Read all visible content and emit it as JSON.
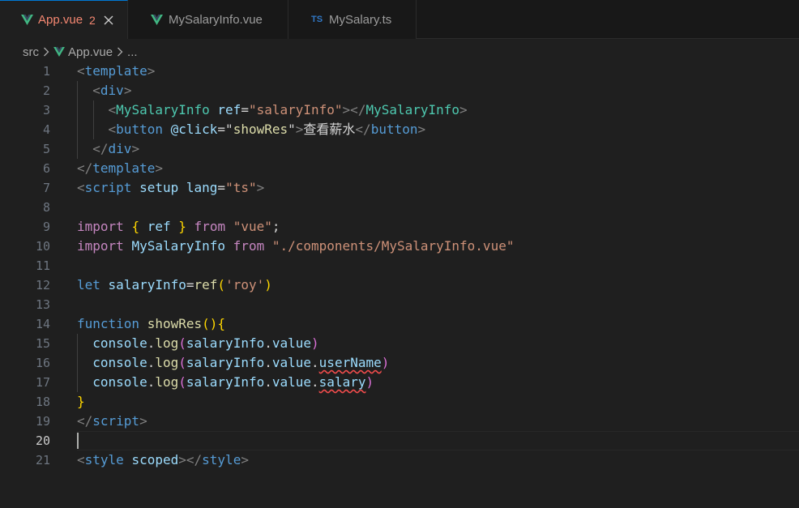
{
  "tabs": [
    {
      "label": "App.vue",
      "badge": "2",
      "icon": "vue-icon",
      "active": true
    },
    {
      "label": "MySalaryInfo.vue",
      "icon": "vue-icon",
      "active": false
    },
    {
      "label": "MySalary.ts",
      "icon": "ts-icon",
      "icon_text": "TS",
      "active": false
    }
  ],
  "breadcrumb": {
    "folder": "src",
    "file": "App.vue",
    "symbol": "..."
  },
  "colors": {
    "vue": "#41b883",
    "ts": "#3178c6",
    "accent": "#0078d4",
    "error": "#f48771"
  },
  "editor": {
    "current_line": 20,
    "lines": [
      {
        "n": "1",
        "tokens": [
          [
            "t-br",
            "<"
          ],
          [
            "t-tag",
            "template"
          ],
          [
            "t-br",
            ">"
          ]
        ]
      },
      {
        "n": "2",
        "tokens": [
          [
            "t-txt",
            "  "
          ],
          [
            "t-br",
            "<"
          ],
          [
            "t-tag",
            "div"
          ],
          [
            "t-br",
            ">"
          ]
        ]
      },
      {
        "n": "3",
        "tokens": [
          [
            "t-txt",
            "    "
          ],
          [
            "t-br",
            "<"
          ],
          [
            "t-comp",
            "MySalaryInfo"
          ],
          [
            "t-txt",
            " "
          ],
          [
            "t-attr",
            "ref"
          ],
          [
            "t-txt",
            "="
          ],
          [
            "t-str",
            "\"salaryInfo\""
          ],
          [
            "t-br",
            "></"
          ],
          [
            "t-comp",
            "MySalaryInfo"
          ],
          [
            "t-br",
            ">"
          ]
        ]
      },
      {
        "n": "4",
        "tokens": [
          [
            "t-txt",
            "    "
          ],
          [
            "t-br",
            "<"
          ],
          [
            "t-tag",
            "button"
          ],
          [
            "t-txt",
            " "
          ],
          [
            "t-attr",
            "@click"
          ],
          [
            "t-txt",
            "="
          ],
          [
            "t-txt",
            "\""
          ],
          [
            "t-fn",
            "showRes"
          ],
          [
            "t-txt",
            "\""
          ],
          [
            "t-br",
            ">"
          ],
          [
            "t-txt",
            "查看薪水"
          ],
          [
            "t-br",
            "</"
          ],
          [
            "t-tag",
            "button"
          ],
          [
            "t-br",
            ">"
          ]
        ]
      },
      {
        "n": "5",
        "tokens": [
          [
            "t-txt",
            "  "
          ],
          [
            "t-br",
            "</"
          ],
          [
            "t-tag",
            "div"
          ],
          [
            "t-br",
            ">"
          ]
        ]
      },
      {
        "n": "6",
        "tokens": [
          [
            "t-br",
            "</"
          ],
          [
            "t-tag",
            "template"
          ],
          [
            "t-br",
            ">"
          ]
        ]
      },
      {
        "n": "7",
        "tokens": [
          [
            "t-br",
            "<"
          ],
          [
            "t-tag",
            "script"
          ],
          [
            "t-txt",
            " "
          ],
          [
            "t-attr",
            "setup"
          ],
          [
            "t-txt",
            " "
          ],
          [
            "t-attr",
            "lang"
          ],
          [
            "t-txt",
            "="
          ],
          [
            "t-str",
            "\"ts\""
          ],
          [
            "t-br",
            ">"
          ]
        ]
      },
      {
        "n": "8",
        "tokens": []
      },
      {
        "n": "9",
        "tokens": [
          [
            "t-kw",
            "import"
          ],
          [
            "t-txt",
            " "
          ],
          [
            "t-p1",
            "{"
          ],
          [
            "t-txt",
            " "
          ],
          [
            "t-var",
            "ref"
          ],
          [
            "t-txt",
            " "
          ],
          [
            "t-p1",
            "}"
          ],
          [
            "t-txt",
            " "
          ],
          [
            "t-kw",
            "from"
          ],
          [
            "t-txt",
            " "
          ],
          [
            "t-str",
            "\"vue\""
          ],
          [
            "t-txt",
            ";"
          ]
        ]
      },
      {
        "n": "10",
        "tokens": [
          [
            "t-kw",
            "import"
          ],
          [
            "t-txt",
            " "
          ],
          [
            "t-var",
            "MySalaryInfo"
          ],
          [
            "t-txt",
            " "
          ],
          [
            "t-kw",
            "from"
          ],
          [
            "t-txt",
            " "
          ],
          [
            "t-str",
            "\"./components/MySalaryInfo.vue\""
          ]
        ]
      },
      {
        "n": "11",
        "tokens": []
      },
      {
        "n": "12",
        "tokens": [
          [
            "t-kb",
            "let"
          ],
          [
            "t-txt",
            " "
          ],
          [
            "t-var",
            "salaryInfo"
          ],
          [
            "t-txt",
            "="
          ],
          [
            "t-fn",
            "ref"
          ],
          [
            "t-p1",
            "("
          ],
          [
            "t-str",
            "'roy'"
          ],
          [
            "t-p1",
            ")"
          ]
        ]
      },
      {
        "n": "13",
        "tokens": []
      },
      {
        "n": "14",
        "tokens": [
          [
            "t-kb",
            "function"
          ],
          [
            "t-txt",
            " "
          ],
          [
            "t-fn",
            "showRes"
          ],
          [
            "t-p1",
            "()"
          ],
          [
            "t-p1",
            "{"
          ]
        ]
      },
      {
        "n": "15",
        "tokens": [
          [
            "t-txt",
            "  "
          ],
          [
            "t-var",
            "console"
          ],
          [
            "t-txt",
            "."
          ],
          [
            "t-fn",
            "log"
          ],
          [
            "t-p2",
            "("
          ],
          [
            "t-var",
            "salaryInfo"
          ],
          [
            "t-txt",
            "."
          ],
          [
            "t-var",
            "value"
          ],
          [
            "t-p2",
            ")"
          ]
        ]
      },
      {
        "n": "16",
        "tokens": [
          [
            "t-txt",
            "  "
          ],
          [
            "t-var",
            "console"
          ],
          [
            "t-txt",
            "."
          ],
          [
            "t-fn",
            "log"
          ],
          [
            "t-p2",
            "("
          ],
          [
            "t-var",
            "salaryInfo"
          ],
          [
            "t-txt",
            "."
          ],
          [
            "t-var",
            "value"
          ],
          [
            "t-txt",
            "."
          ],
          [
            "t-var squiggle",
            "userName"
          ],
          [
            "t-p2",
            ")"
          ]
        ]
      },
      {
        "n": "17",
        "tokens": [
          [
            "t-txt",
            "  "
          ],
          [
            "t-var",
            "console"
          ],
          [
            "t-txt",
            "."
          ],
          [
            "t-fn",
            "log"
          ],
          [
            "t-p2",
            "("
          ],
          [
            "t-var",
            "salaryInfo"
          ],
          [
            "t-txt",
            "."
          ],
          [
            "t-var",
            "value"
          ],
          [
            "t-txt",
            "."
          ],
          [
            "t-var squiggle",
            "salary"
          ],
          [
            "t-p2",
            ")"
          ]
        ]
      },
      {
        "n": "18",
        "tokens": [
          [
            "t-p1",
            "}"
          ]
        ]
      },
      {
        "n": "19",
        "tokens": [
          [
            "t-br",
            "</"
          ],
          [
            "t-tag",
            "script"
          ],
          [
            "t-br",
            ">"
          ]
        ]
      },
      {
        "n": "20",
        "tokens": []
      },
      {
        "n": "21",
        "tokens": [
          [
            "t-br",
            "<"
          ],
          [
            "t-tag",
            "style"
          ],
          [
            "t-txt",
            " "
          ],
          [
            "t-attr",
            "scoped"
          ],
          [
            "t-br",
            "></"
          ],
          [
            "t-tag",
            "style"
          ],
          [
            "t-br",
            ">"
          ]
        ]
      }
    ]
  }
}
